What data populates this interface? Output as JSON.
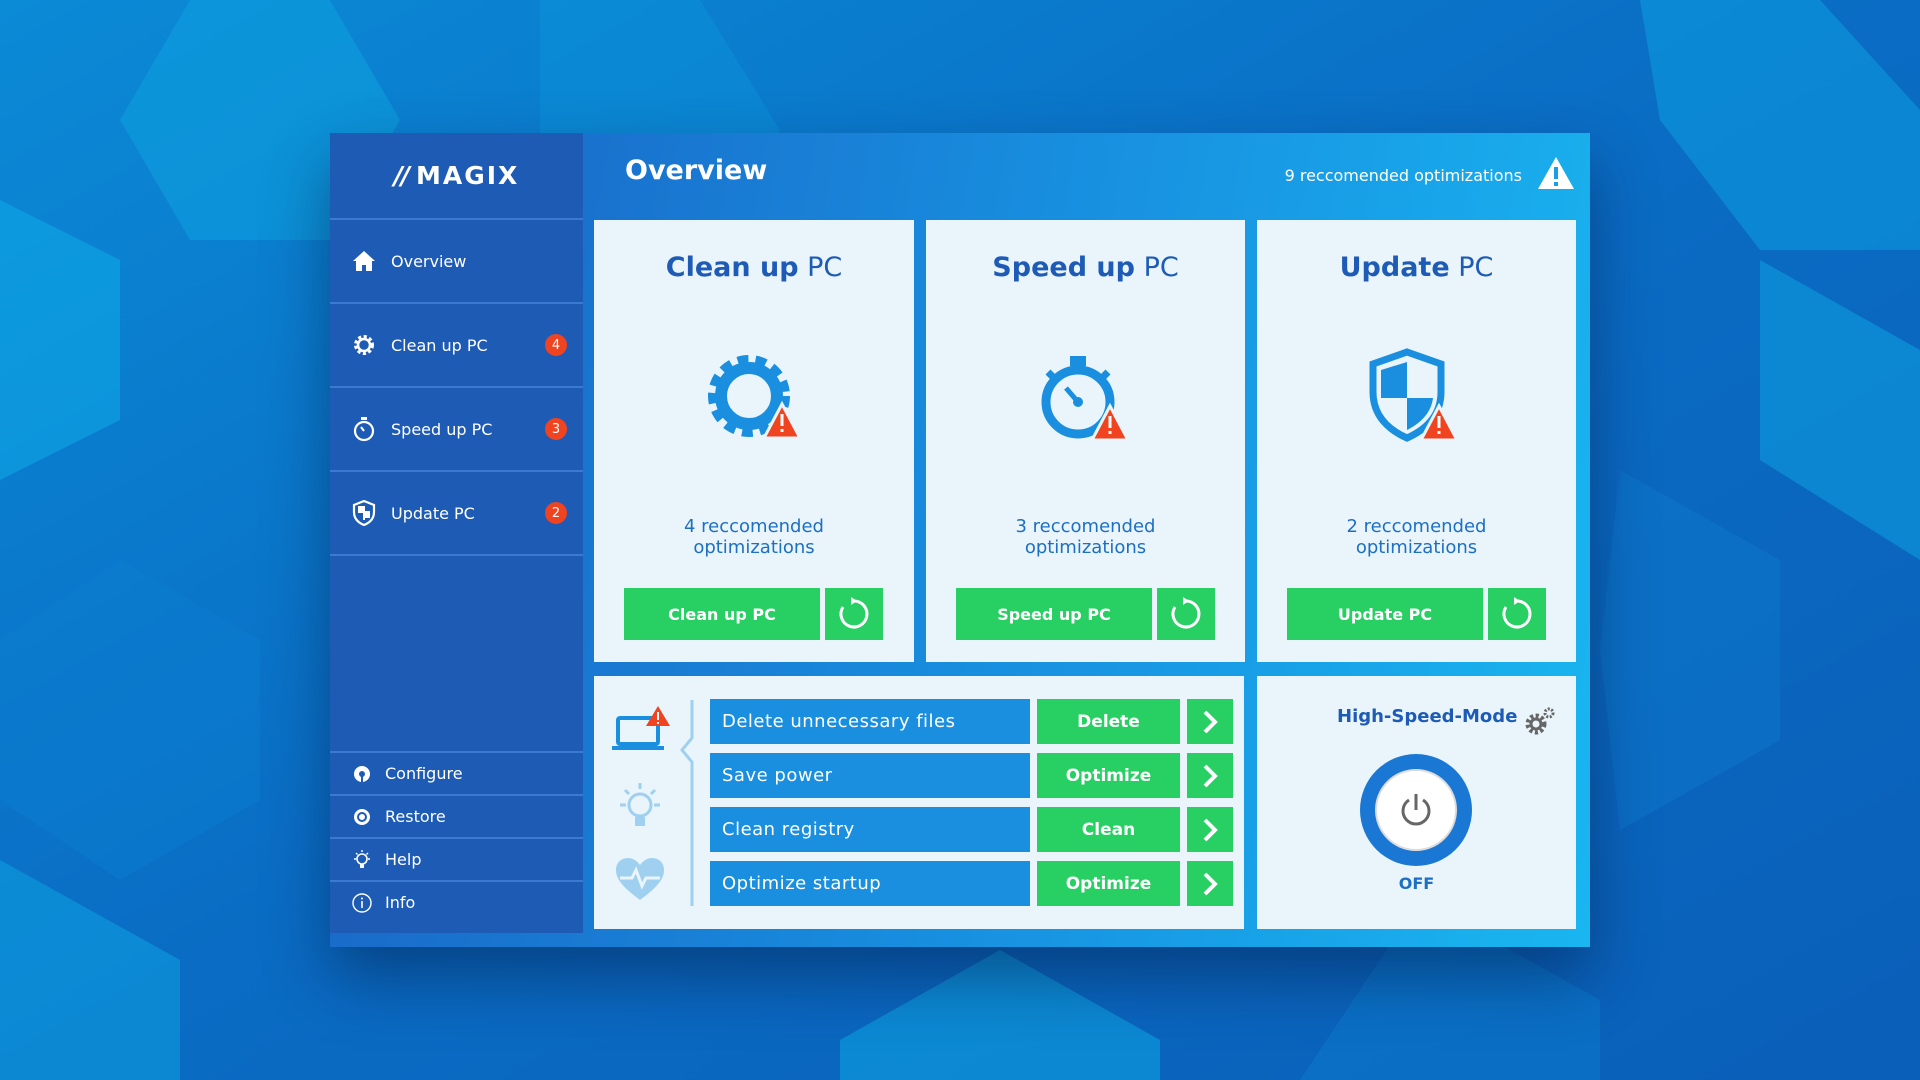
{
  "app": {
    "logo": "MAGIX",
    "logo_prefix": "//",
    "header_title": "Overview",
    "header_status": "9 reccomended optimizations"
  },
  "sidebar": {
    "items": [
      {
        "label": "Overview",
        "icon": "home-icon"
      },
      {
        "label": "Clean up PC",
        "icon": "gear-icon",
        "badge": "4"
      },
      {
        "label": "Speed up PC",
        "icon": "stopwatch-icon",
        "badge": "3"
      },
      {
        "label": "Update PC",
        "icon": "shield-icon",
        "badge": "2"
      }
    ],
    "bottom": [
      {
        "label": "Configure",
        "icon": "configure-icon"
      },
      {
        "label": "Restore",
        "icon": "restore-icon"
      },
      {
        "label": "Help",
        "icon": "lightbulb-icon"
      },
      {
        "label": "Info",
        "icon": "info-icon"
      }
    ]
  },
  "cards": [
    {
      "title_bold": "Clean up",
      "title_rest": " PC",
      "count_line1": "4 reccomended",
      "count_line2": "optimizations",
      "button": "Clean up PC",
      "icon": "gear-warning-icon"
    },
    {
      "title_bold": "Speed up",
      "title_rest": " PC",
      "count_line1": "3 reccomended",
      "count_line2": "optimizations",
      "button": "Speed up PC",
      "icon": "stopwatch-warning-icon"
    },
    {
      "title_bold": "Update",
      "title_rest": " PC",
      "count_line1": "2 reccomended",
      "count_line2": "optimizations",
      "button": "Update PC",
      "icon": "shield-warning-icon"
    }
  ],
  "tasks": [
    {
      "label": "Delete unnecessary files",
      "action": "Delete"
    },
    {
      "label": "Save power",
      "action": "Optimize"
    },
    {
      "label": "Clean registry",
      "action": "Clean"
    },
    {
      "label": "Optimize startup",
      "action": "Optimize"
    }
  ],
  "high_speed_mode": {
    "title": "High-Speed-Mode",
    "state": "OFF"
  },
  "colors": {
    "accent_green": "#28cf62",
    "accent_blue": "#1a8fe0",
    "title_blue": "#1d5bb6",
    "badge_red": "#f0431f",
    "warning_red": "#f0431f"
  }
}
